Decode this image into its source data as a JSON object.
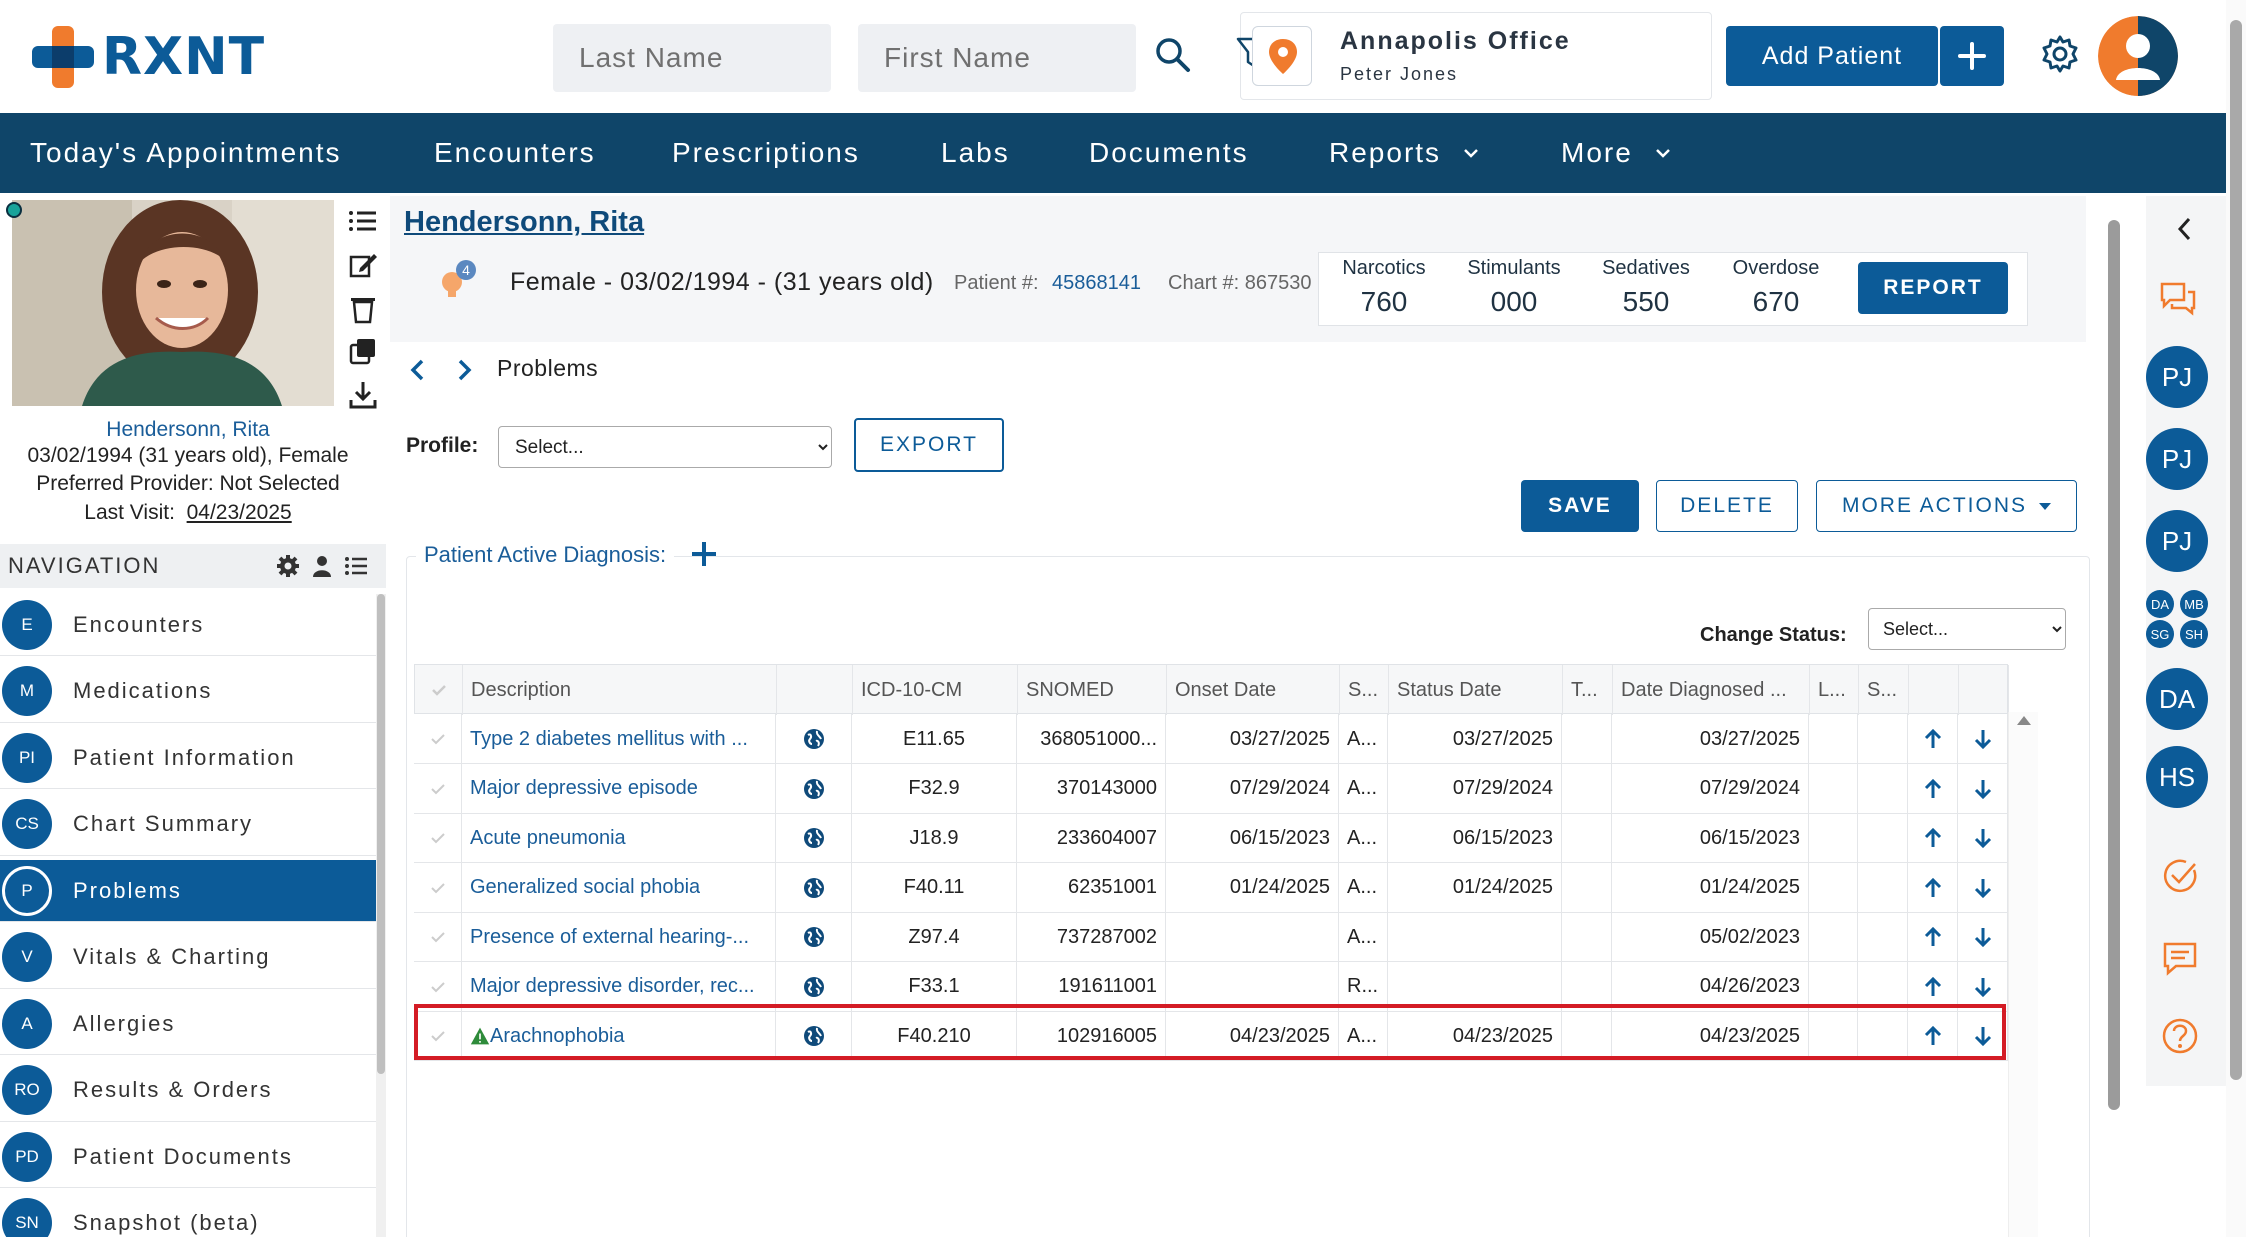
{
  "header": {
    "logo_text": "RXNT",
    "last_name_placeholder": "Last Name",
    "first_name_placeholder": "First Name",
    "office_name": "Annapolis Office",
    "office_user": "Peter Jones",
    "add_patient_label": "Add Patient"
  },
  "main_nav": [
    {
      "label": "Today's Appointments"
    },
    {
      "label": "Encounters"
    },
    {
      "label": "Prescriptions"
    },
    {
      "label": "Labs"
    },
    {
      "label": "Documents"
    },
    {
      "label": "Reports"
    },
    {
      "label": "More"
    }
  ],
  "patient_sidebar": {
    "name": "Hendersonn, Rita",
    "dob_line": "03/02/1994 (31 years old), Female",
    "provider_line": "Preferred Provider: Not Selected",
    "last_visit_label": "Last Visit:",
    "last_visit_date": "04/23/2025"
  },
  "navigation": {
    "title": "NAVIGATION",
    "items": [
      {
        "badge": "E",
        "label": "Encounters"
      },
      {
        "badge": "M",
        "label": "Medications"
      },
      {
        "badge": "PI",
        "label": "Patient Information"
      },
      {
        "badge": "CS",
        "label": "Chart Summary"
      },
      {
        "badge": "P",
        "label": "Problems"
      },
      {
        "badge": "V",
        "label": "Vitals & Charting"
      },
      {
        "badge": "A",
        "label": "Allergies"
      },
      {
        "badge": "RO",
        "label": "Results & Orders"
      },
      {
        "badge": "PD",
        "label": "Patient Documents"
      },
      {
        "badge": "SN",
        "label": "Snapshot (beta)"
      }
    ],
    "active_index": 4
  },
  "patient_header": {
    "name": "Hendersonn, Rita",
    "alert_count": "4",
    "demographics": "Female - 03/02/1994 - (31 years old)",
    "patient_num_label": "Patient #:",
    "patient_num": "45868141",
    "chart_num": "Chart #: 867530",
    "scores": [
      {
        "label": "Narcotics",
        "value": "760"
      },
      {
        "label": "Stimulants",
        "value": "000"
      },
      {
        "label": "Sedatives",
        "value": "550"
      },
      {
        "label": "Overdose",
        "value": "670"
      }
    ],
    "report_label": "REPORT"
  },
  "problems": {
    "section_title": "Problems",
    "profile_label": "Profile:",
    "profile_value": "Select...",
    "export_label": "EXPORT",
    "save_label": "SAVE",
    "delete_label": "DELETE",
    "more_actions_label": "MORE ACTIONS",
    "diagnosis_title": "Patient Active Diagnosis:",
    "change_status_label": "Change Status:",
    "change_status_value": "Select..."
  },
  "grid": {
    "columns": [
      "Description",
      "ICD-10-CM",
      "SNOMED",
      "Onset Date",
      "S...",
      "Status Date",
      "T...",
      "Date Diagnosed ...",
      "L...",
      "S..."
    ],
    "rows": [
      {
        "description": "Type 2 diabetes mellitus with ...",
        "icd": "E11.65",
        "snomed": "368051000...",
        "onset": "03/27/2025",
        "status": "A...",
        "status_date": "03/27/2025",
        "diagnosed": "03/27/2025",
        "warning": false
      },
      {
        "description": "Major depressive episode",
        "icd": "F32.9",
        "snomed": "370143000",
        "onset": "07/29/2024",
        "status": "A...",
        "status_date": "07/29/2024",
        "diagnosed": "07/29/2024",
        "warning": false
      },
      {
        "description": "Acute pneumonia",
        "icd": "J18.9",
        "snomed": "233604007",
        "onset": "06/15/2023",
        "status": "A...",
        "status_date": "06/15/2023",
        "diagnosed": "06/15/2023",
        "warning": false
      },
      {
        "description": "Generalized social phobia",
        "icd": "F40.11",
        "snomed": "62351001",
        "onset": "01/24/2025",
        "status": "A...",
        "status_date": "01/24/2025",
        "diagnosed": "01/24/2025",
        "warning": false
      },
      {
        "description": "Presence of external hearing-...",
        "icd": "Z97.4",
        "snomed": "737287002",
        "onset": "",
        "status": "A...",
        "status_date": "",
        "diagnosed": "05/02/2023",
        "warning": false
      },
      {
        "description": "Major depressive disorder, rec...",
        "icd": "F33.1",
        "snomed": "191611001",
        "onset": "",
        "status": "R...",
        "status_date": "",
        "diagnosed": "04/26/2023",
        "warning": false
      },
      {
        "description": "Arachnophobia",
        "icd": "F40.210",
        "snomed": "102916005",
        "onset": "04/23/2025",
        "status": "A...",
        "status_date": "04/23/2025",
        "diagnosed": "04/23/2025",
        "warning": true
      }
    ]
  },
  "right_rail": {
    "avatars": [
      "PJ",
      "PJ",
      "PJ",
      "DA",
      "HS"
    ],
    "mini_avatars": [
      "DA",
      "MB",
      "SG",
      "SH"
    ]
  },
  "colors": {
    "brand_blue": "#0c5b98",
    "nav_bg": "#0f4569",
    "accent_orange": "#f07b2d",
    "highlight_red": "#d41c25",
    "warning_green": "#2e8b3a"
  }
}
